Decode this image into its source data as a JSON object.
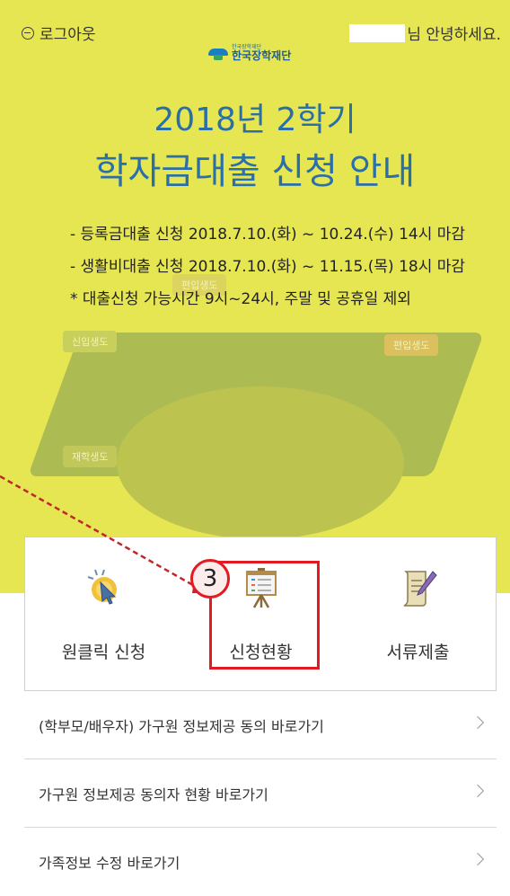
{
  "header": {
    "logout_label": "로그아웃",
    "greeting_suffix": "님 안녕하세요."
  },
  "org": {
    "small_text": "한국장학재단",
    "name": "한국장학재단"
  },
  "banner": {
    "title_line1": "2018년 2학기",
    "title_line2": "학자금대출 신청 안내",
    "notices": [
      "- 등록금대출 신청   2018.7.10.(화) ~ 10.24.(수) 14시 마감",
      "- 생활비대출 신청   2018.7.10.(화) ~ 11.15.(목) 18시 마감",
      "* 대출신청 가능시간 9시~24시, 주말 및 공휴일 제외"
    ],
    "tags": [
      "신입생도",
      "편입생도",
      "편입생도",
      "재학생도"
    ]
  },
  "menu": {
    "items": [
      {
        "label": "원클릭 신청",
        "icon": "cursor-click-icon"
      },
      {
        "label": "신청현황",
        "icon": "presentation-board-icon"
      },
      {
        "label": "서류제출",
        "icon": "document-pen-icon"
      }
    ]
  },
  "annotation": {
    "step_number": "3",
    "color": "#e21b23"
  },
  "links": [
    {
      "label": "(학부모/배우자) 가구원 정보제공 동의 바로가기"
    },
    {
      "label": "가구원 정보제공 동의자 현황 바로가기"
    },
    {
      "label": "가족정보 수정 바로가기"
    }
  ],
  "colors": {
    "banner_bg": "#e6e552",
    "title": "#2a6fa8"
  }
}
